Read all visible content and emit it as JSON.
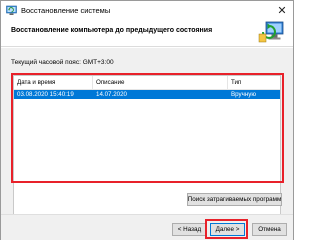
{
  "window": {
    "title": "Восстановление системы",
    "close_glyph": "✕",
    "icons": {
      "title": "system-restore-icon",
      "header": "computer-restore-icon"
    }
  },
  "header": {
    "title": "Восстановление компьютера до предыдущего состояния"
  },
  "timezone": {
    "text": "Текущий часовой пояс: GMT+3:00"
  },
  "restore_points": {
    "columns": [
      "Дата и время",
      "Описание",
      "Тип"
    ],
    "rows": [
      {
        "datetime": "03.08.2020 15:40:19",
        "description": "14.07.2020",
        "type": "Вручную",
        "selected": true
      }
    ]
  },
  "buttons": {
    "find_programs": "Поиск затрагиваемых программ",
    "back": "< Назад",
    "next": "Далее >",
    "cancel": "Отмена"
  },
  "colors": {
    "selection": "#0078d7",
    "highlight": "#e8212a"
  }
}
